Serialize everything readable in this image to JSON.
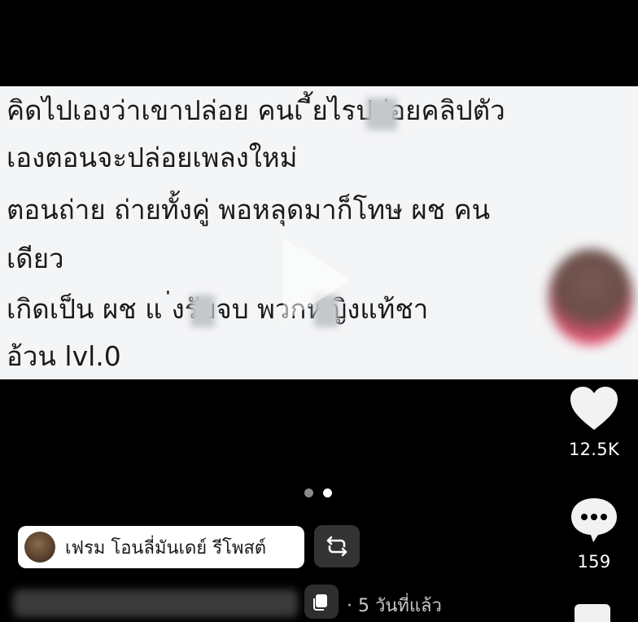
{
  "post": {
    "lines": [
      "คิดไปเองว่าเขาปล่อย คนเ  ี้ยไรปล่อยคลิปตัว",
      "เองตอนจะปล่อยเพลงใหม่",
      "ตอนถ่าย ถ่ายทั้งคู่ พอหลุดมาก็โทษ ผช คน",
      "เดียว",
      "เกิดเป็น ผช แ  ่งรับจบ   พวกหญิงแท้ชา",
      "อ้วน lvl.0"
    ]
  },
  "actions": {
    "like_count": "12.5K",
    "comment_count": "159",
    "like_icon": "heart-icon",
    "comment_icon": "comment-bubble-icon"
  },
  "carousel": {
    "total": 2,
    "active_index": 1
  },
  "sound": {
    "label": "เฟรม โอนลี่มันเดย์ รีโพสต์"
  },
  "meta": {
    "time": "· 5 วันที่แล้ว"
  },
  "colors": {
    "background": "#000000",
    "card": "#f4f5f6",
    "text_dark": "#1a1a1a",
    "muted": "#c8c8c8"
  }
}
